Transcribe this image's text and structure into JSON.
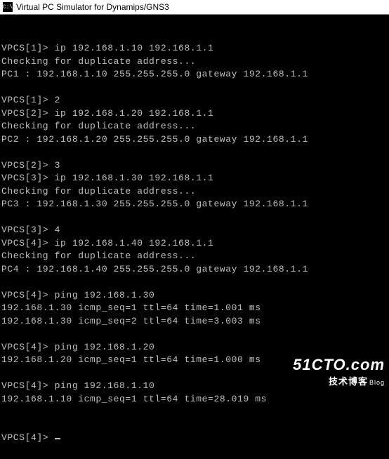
{
  "window": {
    "icon_label": "C:\\",
    "title": "Virtual PC Simulator for Dynamips/GNS3"
  },
  "lines": [
    "VPCS[1]> ip 192.168.1.10 192.168.1.1",
    "Checking for duplicate address...",
    "PC1 : 192.168.1.10 255.255.255.0 gateway 192.168.1.1",
    "",
    "VPCS[1]> 2",
    "VPCS[2]> ip 192.168.1.20 192.168.1.1",
    "Checking for duplicate address...",
    "PC2 : 192.168.1.20 255.255.255.0 gateway 192.168.1.1",
    "",
    "VPCS[2]> 3",
    "VPCS[3]> ip 192.168.1.30 192.168.1.1",
    "Checking for duplicate address...",
    "PC3 : 192.168.1.30 255.255.255.0 gateway 192.168.1.1",
    "",
    "VPCS[3]> 4",
    "VPCS[4]> ip 192.168.1.40 192.168.1.1",
    "Checking for duplicate address...",
    "PC4 : 192.168.1.40 255.255.255.0 gateway 192.168.1.1",
    "",
    "VPCS[4]> ping 192.168.1.30",
    "192.168.1.30 icmp_seq=1 ttl=64 time=1.001 ms",
    "192.168.1.30 icmp_seq=2 ttl=64 time=3.003 ms",
    "",
    "VPCS[4]> ping 192.168.1.20",
    "192.168.1.20 icmp_seq=1 ttl=64 time=1.000 ms",
    "",
    "VPCS[4]> ping 192.168.1.10",
    "192.168.1.10 icmp_seq=1 ttl=64 time=28.019 ms"
  ],
  "current_prompt": "VPCS[4]> ",
  "watermark": {
    "big": "51CTO.com",
    "small": "技术博客",
    "tag": "Blog"
  }
}
